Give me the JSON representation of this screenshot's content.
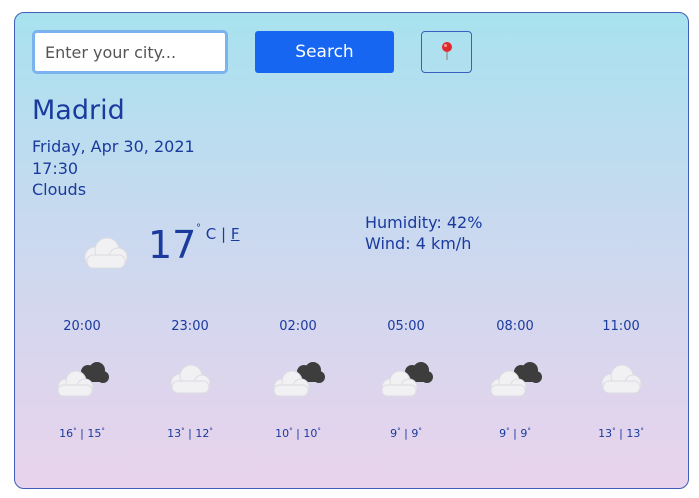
{
  "search": {
    "placeholder": "Enter your city...",
    "button_label": "Search"
  },
  "location": {
    "icon": "map-pin-icon"
  },
  "current": {
    "city": "Madrid",
    "date": "Friday, Apr 30, 2021",
    "time": "17:30",
    "condition": "Clouds",
    "temperature": "17",
    "unit_c": "C",
    "unit_sep": "|",
    "unit_f": "F",
    "humidity": "Humidity: 42%",
    "wind": "Wind: 4 km/h",
    "icon": "cloud-icon"
  },
  "forecast": [
    {
      "time": "20:00",
      "high": "16",
      "low": "15",
      "icon": "broken-clouds-icon"
    },
    {
      "time": "23:00",
      "high": "13",
      "low": "12",
      "icon": "cloud-icon"
    },
    {
      "time": "02:00",
      "high": "10",
      "low": "10",
      "icon": "broken-clouds-icon"
    },
    {
      "time": "05:00",
      "high": "9",
      "low": "9",
      "icon": "broken-clouds-icon"
    },
    {
      "time": "08:00",
      "high": "9",
      "low": "9",
      "icon": "broken-clouds-icon"
    },
    {
      "time": "11:00",
      "high": "13",
      "low": "13",
      "icon": "cloud-icon"
    }
  ],
  "colors": {
    "accent": "#1666f2",
    "text": "#1a3a9e",
    "border": "#3d5fb8"
  }
}
